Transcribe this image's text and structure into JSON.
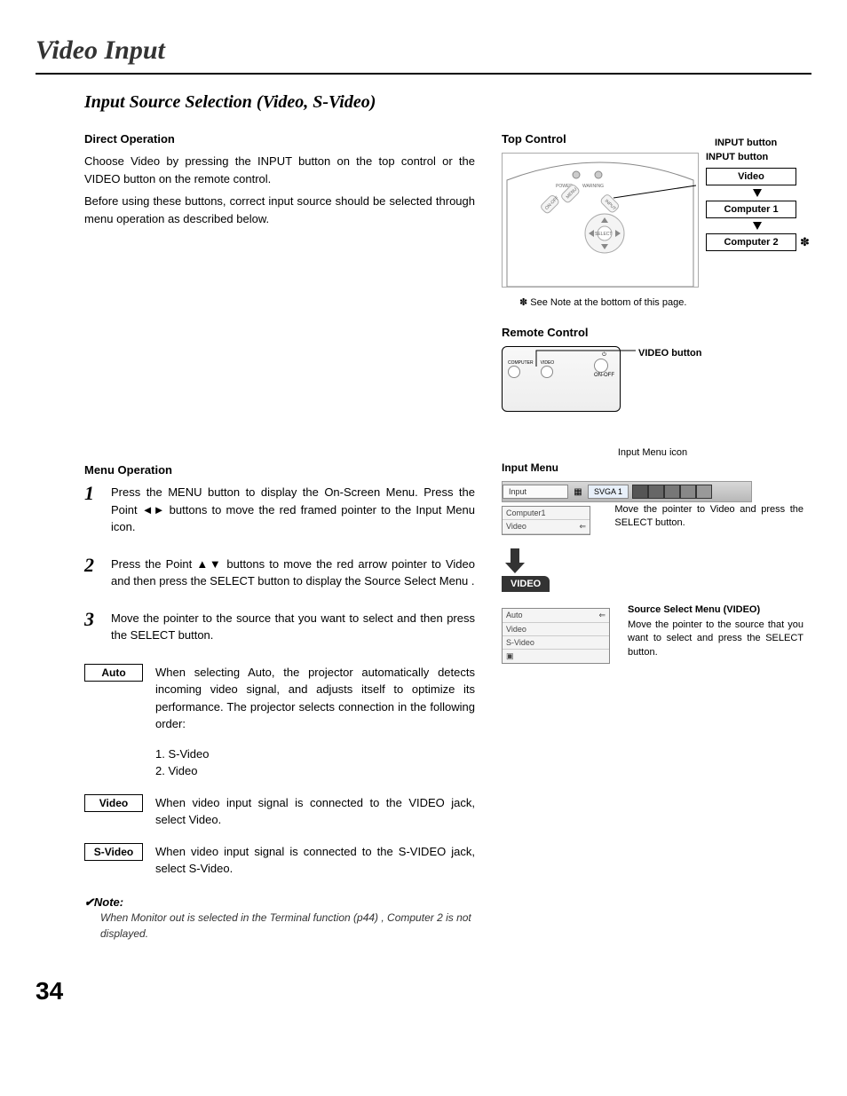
{
  "page_title": "Video Input",
  "section_title": "Input Source Selection (Video, S-Video)",
  "direct_op": {
    "heading": "Direct Operation",
    "p1": "Choose Video by pressing the INPUT button on the top control or the VIDEO button on the remote control.",
    "p2": "Before using these buttons, correct input source should be selected through menu operation as described below."
  },
  "menu_op": {
    "heading": "Menu Operation",
    "step1": "Press the MENU button to display the On-Screen Menu.  Press the Point ◄► buttons to move the red framed pointer to the Input Menu icon.",
    "step2": "Press the Point ▲▼ buttons to move the red arrow pointer to Video and then press the SELECT button to display the Source Select Menu .",
    "step3": "Move the pointer to the source that you want to select and then press the SELECT button."
  },
  "options": {
    "auto_label": "Auto",
    "auto_text": "When selecting Auto, the projector automatically detects incoming video signal, and adjusts itself to optimize its performance.  The projector selects connection in the following order:",
    "auto_order1": "1. S-Video",
    "auto_order2": "2. Video",
    "video_label": "Video",
    "video_text": "When video input signal is connected to the VIDEO jack, select Video.",
    "svideo_label": "S-Video",
    "svideo_text": "When video input signal is connected to the S-VIDEO jack, select S-Video."
  },
  "note": {
    "head": "✔Note:",
    "body": "When Monitor out is selected in the Terminal function (p44) , Computer 2 is not displayed."
  },
  "right": {
    "top_control": "Top Control",
    "input_button": "INPUT button",
    "input_button2": "INPUT button",
    "cycle1": "Video",
    "cycle2": "Computer 1",
    "cycle3": "Computer 2",
    "asterisk": "✽",
    "see_note": "✽ See Note at the bottom of this page.",
    "remote_control": "Remote Control",
    "video_button": "VIDEO button",
    "rc_labels": {
      "computer": "COMPUTER",
      "video": "VIDEO",
      "on_off": "ON-OFF"
    },
    "tc_labels": {
      "power": "POWER",
      "warning": "WARNING",
      "on_off": "ON-OFF",
      "menu": "MENU",
      "input": "INPUT",
      "select": "SELECT"
    },
    "input_menu_icon": "Input Menu icon",
    "input_menu": "Input Menu",
    "menu_input": "Input",
    "menu_svga": "SVGA 1",
    "menu_computer1": "Computer1",
    "menu_video": "Video",
    "move_pointer": "Move the pointer to Video and press the SELECT button.",
    "video_tag": "VIDEO",
    "ss_auto": "Auto",
    "ss_video": "Video",
    "ss_svideo": "S-Video",
    "ss_title": "Source Select Menu (VIDEO)",
    "ss_desc": "Move the pointer to the source that you want to select and press the SELECT button."
  },
  "page_number": "34"
}
